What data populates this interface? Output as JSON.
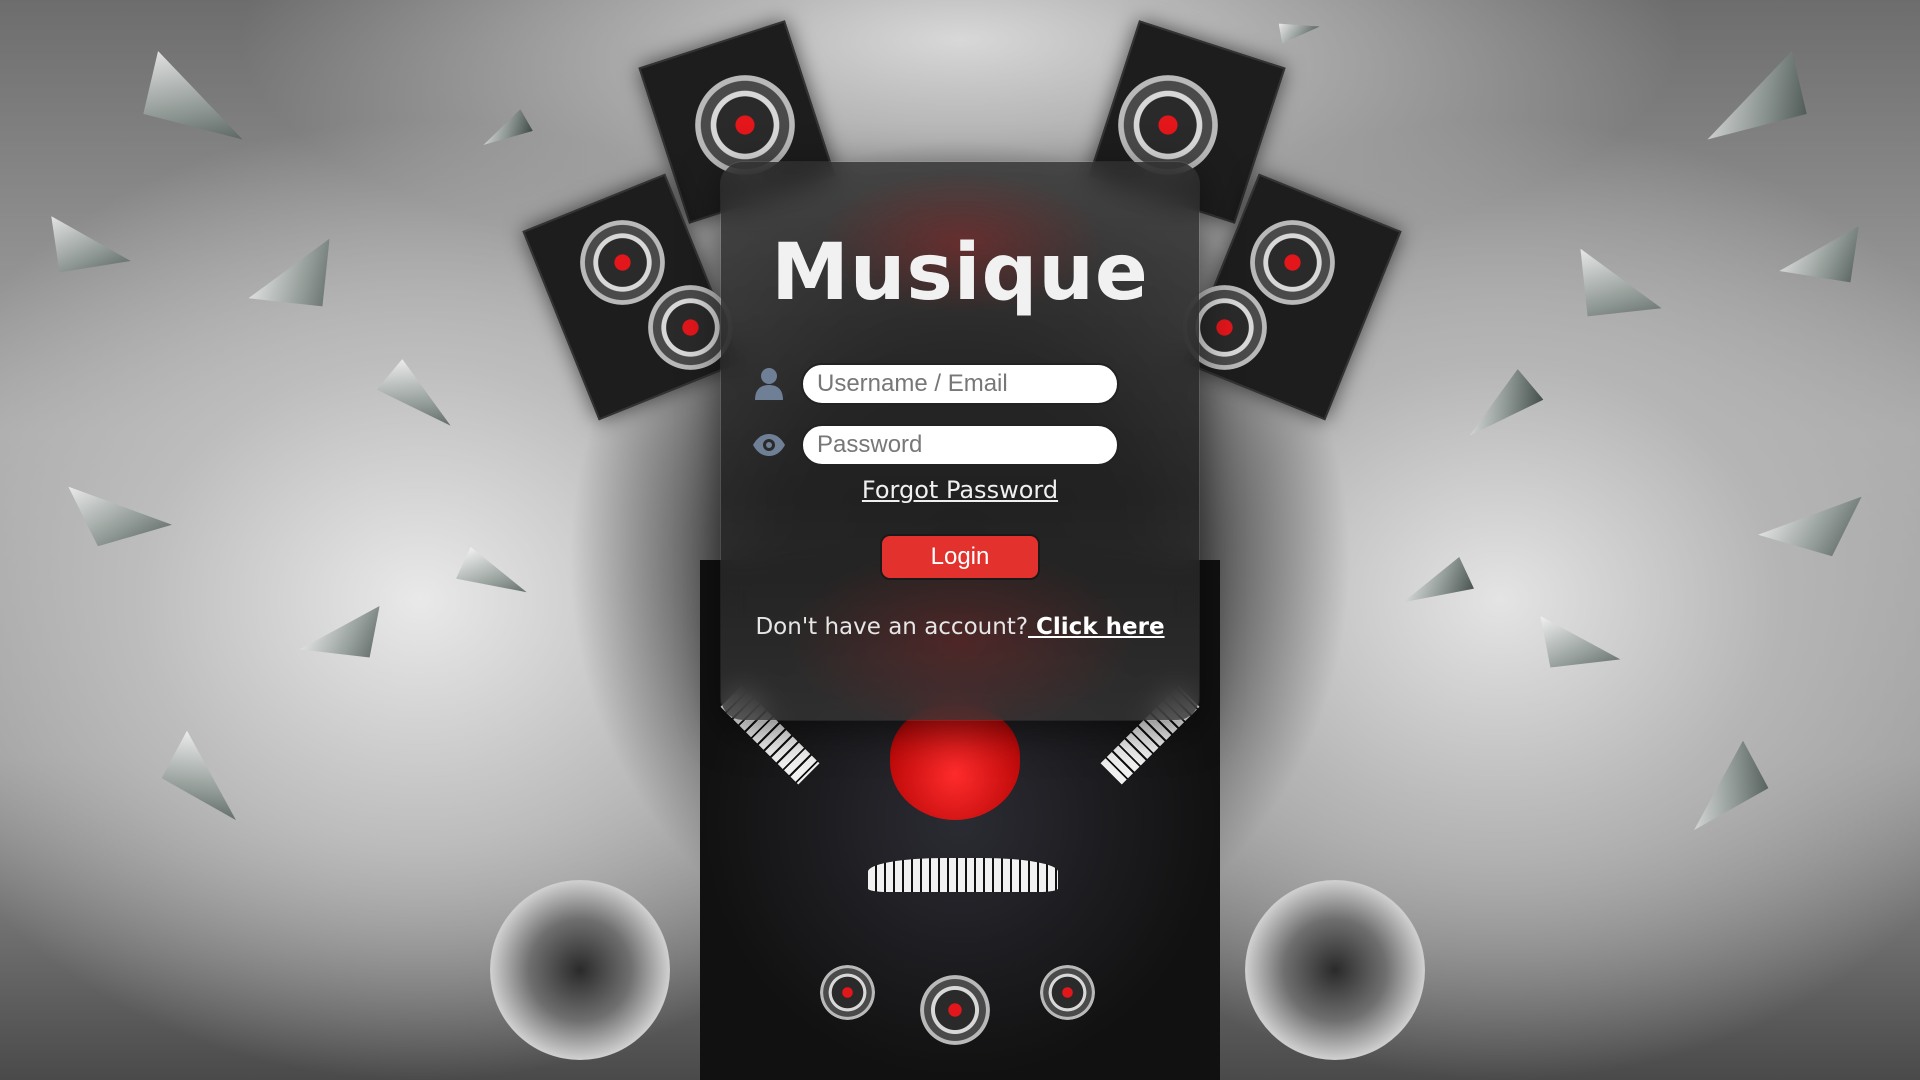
{
  "app": {
    "title": "Musique"
  },
  "login_form": {
    "username_placeholder": "Username / Email",
    "username_value": "",
    "password_placeholder": "Password",
    "password_value": "",
    "forgot_password_label": "Forgot Password",
    "login_button_label": "Login",
    "signup_prompt": "Don't have an account?",
    "signup_link_label": " Click here",
    "user_icon": "user-icon",
    "password_icon": "eye-icon"
  },
  "colors": {
    "accent": "#e3312d",
    "icon": "#6f7f96",
    "card_bg": "rgba(60,60,60,0.55)"
  }
}
